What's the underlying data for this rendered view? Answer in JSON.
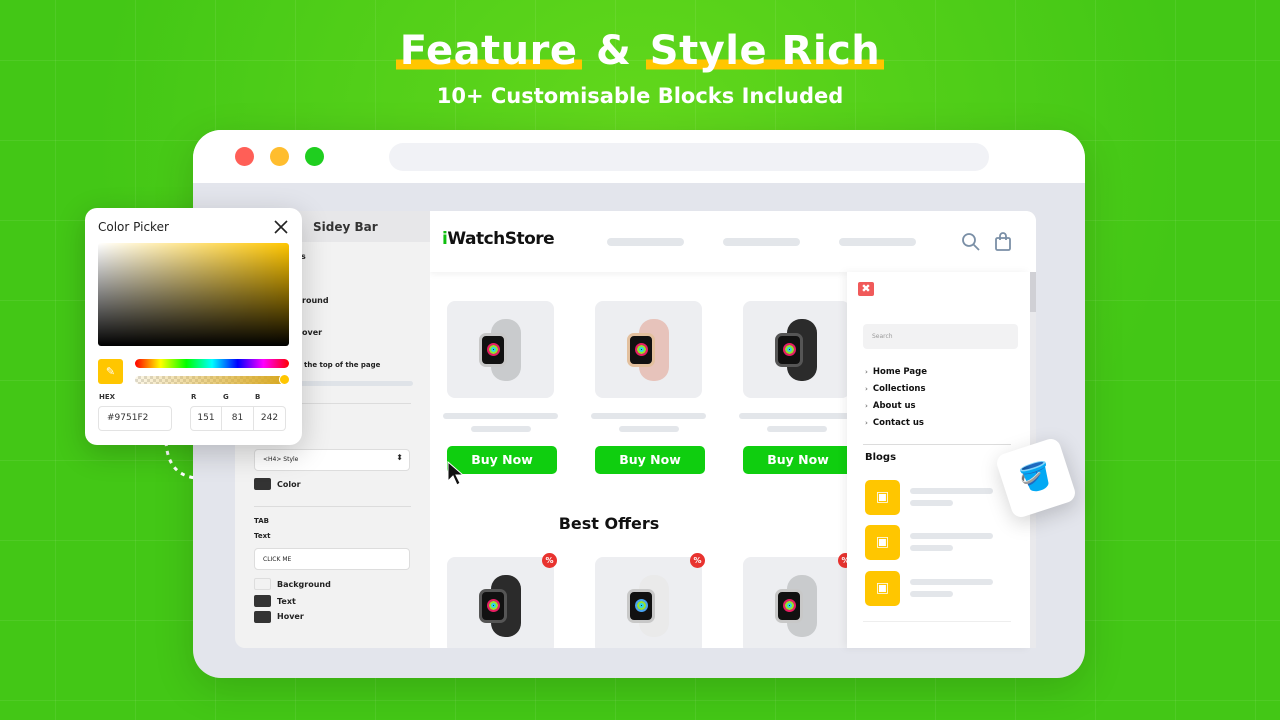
{
  "hero": {
    "title_part1": "Feature",
    "title_amp": "&",
    "title_part2": "Style Rich",
    "subtitle": "10+ Customisable Blocks Included"
  },
  "window": {
    "dots": [
      "#ff5f57",
      "#ffbd2e",
      "#28c840"
    ]
  },
  "sidebar": {
    "title": "Sidey Bar",
    "fragments": [
      "s",
      "round",
      "over",
      "the top of the page"
    ],
    "heading_style": "<H4> Style",
    "color_label": "Color",
    "tab_label": "TAB",
    "text_label": "Text",
    "text_value": "CLICK ME",
    "swatches": [
      "Background",
      "Text",
      "Hover"
    ]
  },
  "color_picker": {
    "title": "Color Picker",
    "hex_label": "HEX",
    "hex": "#9751F2",
    "r_label": "R",
    "g_label": "G",
    "b_label": "B",
    "r": "151",
    "g": "81",
    "b": "242",
    "alpha": 1
  },
  "store": {
    "logo_prefix": "i",
    "logo_rest": "WatchStore",
    "products": [
      {
        "band": "#c9cbcd",
        "buy": "Buy Now"
      },
      {
        "band": "#e7c3bb",
        "buy": "Buy Now"
      },
      {
        "band": "#2b2b2b",
        "buy": "Buy Now"
      }
    ],
    "offers_title": "Best Offers",
    "offers": [
      {
        "band": "#2b2b2b",
        "badge": "%"
      },
      {
        "band": "#eaeaea",
        "badge": "%"
      },
      {
        "band": "#c9cbcd",
        "badge": "%"
      }
    ]
  },
  "drawer": {
    "close": "✖",
    "search_placeholder": "Search",
    "menu": [
      "Home Page",
      "Collections",
      "About us",
      "Contact us"
    ],
    "blogs_title": "Blogs"
  },
  "colors": {
    "accent_green": "#0fce0f",
    "accent_yellow": "#ffc600"
  }
}
